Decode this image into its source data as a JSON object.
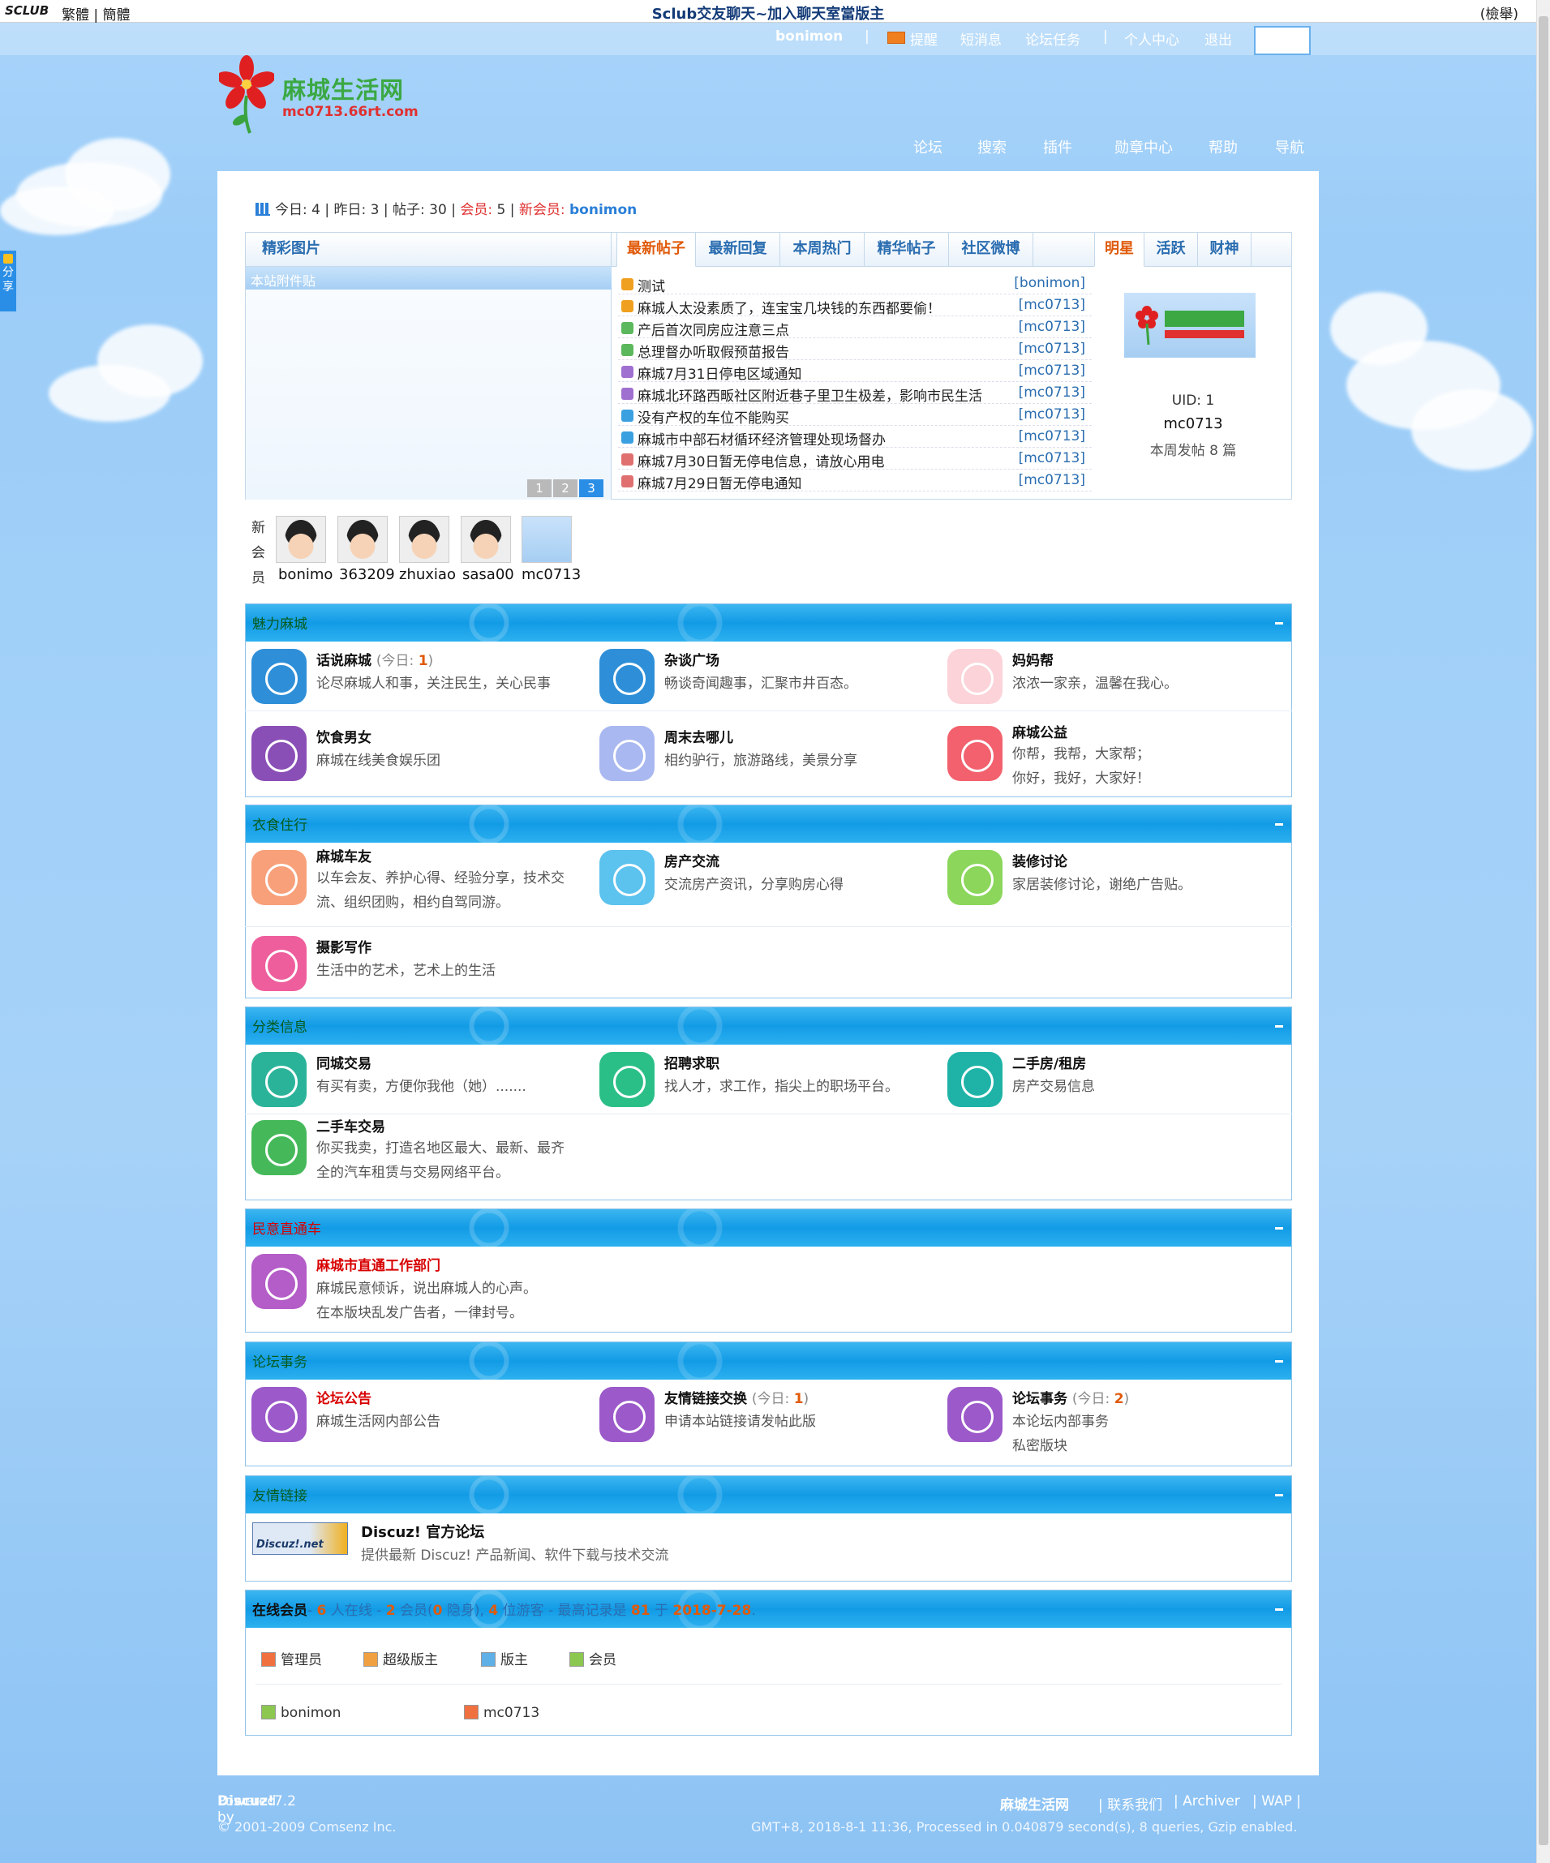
{
  "topbar": {
    "brand": "SCLUB",
    "lang_trad": "繁體",
    "lang_simp": "簡體",
    "marquee": "Sclub交友聊天~加入聊天室當版主",
    "report": "(檢舉)"
  },
  "userbar": {
    "username": "bonimon",
    "remind": "提醒",
    "sms": "短消息",
    "task": "论坛任务",
    "center": "个人中心",
    "logout": "退出",
    "sep": "|"
  },
  "logo": {
    "name": "麻城生活网",
    "url": "mc0713.66rt.com"
  },
  "nav": [
    "论坛",
    "搜索",
    "插件",
    "勋章中心",
    "帮助",
    "导航"
  ],
  "stats": {
    "today_label": "今日:",
    "today": "4",
    "yesterday_label": "昨日:",
    "yesterday": "3",
    "posts_label": "帖子:",
    "posts": "30",
    "members_label": "会员:",
    "members": "5",
    "newmember_label": "新会员:",
    "newmember": "bonimon"
  },
  "pics": {
    "tab": "精彩图片",
    "bar": "本站附件贴",
    "pages": [
      "1",
      "2",
      "3"
    ]
  },
  "post_tabs": [
    "最新帖子",
    "最新回复",
    "本周热门",
    "精华帖子",
    "社区微博"
  ],
  "posts": [
    {
      "title": "测试",
      "author": "[bonimon]",
      "color": "#f0a020"
    },
    {
      "title": "麻城人太没素质了，连宝宝几块钱的东西都要偷！",
      "author": "[mc0713]",
      "color": "#f0a020"
    },
    {
      "title": "产后首次同房应注意三点",
      "author": "[mc0713]",
      "color": "#5cb85c"
    },
    {
      "title": "总理督办听取假预苗报告",
      "author": "[mc0713]",
      "color": "#5cb85c"
    },
    {
      "title": "麻城7月31日停电区域通知",
      "author": "[mc0713]",
      "color": "#a070d0"
    },
    {
      "title": "麻城北环路西畈社区附近巷子里卫生极差，影响市民生活",
      "author": "[mc0713]",
      "color": "#a070d0"
    },
    {
      "title": "没有产权的车位不能购买",
      "author": "[mc0713]",
      "color": "#3aa0e0"
    },
    {
      "title": "麻城市中部石材循环经济管理处现场督办",
      "author": "[mc0713]",
      "color": "#3aa0e0"
    },
    {
      "title": "麻城7月30日暂无停电信息，请放心用电",
      "author": "[mc0713]",
      "color": "#e07070"
    },
    {
      "title": "麻城7月29日暂无停电通知",
      "author": "[mc0713]",
      "color": "#e07070"
    }
  ],
  "star_tabs": [
    "明星",
    "活跃",
    "财神"
  ],
  "star": {
    "uid": "UID: 1",
    "name": "mc0713",
    "week": "本周发帖 8 篇"
  },
  "new_members": {
    "label": "新\n会\n员",
    "names": [
      "bonimo",
      "363209",
      "zhuxiao",
      "sasa00",
      "mc0713"
    ]
  },
  "categories": [
    {
      "title": "魅力麻城",
      "forums": [
        {
          "name": "话说麻城",
          "today": "1",
          "desc": [
            "论尽麻城人和事，关注民生，关心民事"
          ],
          "color": "#2e8fd8"
        },
        {
          "name": "杂谈广场",
          "desc": [
            "畅谈奇闻趣事，汇聚市井百态。"
          ],
          "color": "#2e8fd8"
        },
        {
          "name": "妈妈帮",
          "desc": [
            "浓浓一家亲，温馨在我心。"
          ],
          "color": "#fbd3d8"
        },
        {
          "name": "饮食男女",
          "desc": [
            "麻城在线美食娱乐团"
          ],
          "color": "#8a4fb6"
        },
        {
          "name": "周末去哪儿",
          "desc": [
            "相约驴行，旅游路线，美景分享"
          ],
          "color": "#a9b8f0"
        },
        {
          "name": "麻城公益",
          "desc": [
            "你帮，我帮，大家帮；",
            "你好，我好，大家好！"
          ],
          "color": "#f2616d"
        }
      ]
    },
    {
      "title": "衣食住行",
      "forums": [
        {
          "name": "麻城车友",
          "desc": [
            "以车会友、养护心得、经验分享，技术交",
            "流、组织团购，相约自驾同游。"
          ],
          "color": "#f7a07a"
        },
        {
          "name": "房产交流",
          "desc": [
            "交流房产资讯，分享购房心得"
          ],
          "color": "#5cc2ee"
        },
        {
          "name": "装修讨论",
          "desc": [
            "家居装修讨论，谢绝广告贴。"
          ],
          "color": "#8bd65b"
        },
        {
          "name": "摄影写作",
          "desc": [
            "生活中的艺术，艺术上的生活"
          ],
          "color": "#ee5e9c"
        }
      ]
    },
    {
      "title": "分类信息",
      "forums": [
        {
          "name": "同城交易",
          "desc": [
            "有买有卖，方便你我他（她）......."
          ],
          "color": "#2bb39a"
        },
        {
          "name": "招聘求职",
          "desc": [
            "找人才，求工作，指尖上的职场平台。"
          ],
          "color": "#2bbf88"
        },
        {
          "name": "二手房/租房",
          "desc": [
            "房产交易信息"
          ],
          "color": "#1fb3a7"
        },
        {
          "name": "二手车交易",
          "desc": [
            "你买我卖，打造名地区最大、最新、最齐",
            "全的汽车租赁与交易网络平台。"
          ],
          "color": "#45b95a"
        }
      ]
    },
    {
      "title": "民意直通车",
      "forums": [
        {
          "name": "麻城市直通工作部门",
          "desc": [
            "麻城民意倾诉，说出麻城人的心声。",
            "在本版块乱发广告者，一律封号。"
          ],
          "color": "#b45cc8"
        }
      ]
    },
    {
      "title": "论坛事务",
      "forums": [
        {
          "name": "论坛公告",
          "desc": [
            "麻城生活网内部公告"
          ],
          "color": "#9b59c9"
        },
        {
          "name": "友情链接交换",
          "today": "1",
          "desc": [
            "申请本站链接请发帖此版"
          ],
          "color": "#9b59c9"
        },
        {
          "name": "论坛事务",
          "today": "2",
          "desc": [
            "本论坛内部事务",
            "私密版块"
          ],
          "color": "#9b59c9"
        }
      ]
    }
  ],
  "today_label": "(今日:",
  "today_close": ")",
  "links": {
    "title": "友情链接",
    "name": "Discuz! 官方论坛",
    "desc": "提供最新 Discuz! 产品新闻、软件下载与技术交流",
    "logo": "Discuz!.net"
  },
  "online": {
    "title": "在线会员",
    "summary_a": "- ",
    "online": "6",
    "summary_b": " 人在线 - ",
    "members": "2",
    "summary_c": " 会员(",
    "hidden": "0",
    "summary_d": " 隐身), ",
    "guests": "4",
    "summary_e": " 位游客 - 最高记录是 ",
    "record": "81",
    "summary_f": " 于 ",
    "record_date": "2018-7-28",
    "summary_g": ".",
    "legend": [
      "管理员",
      "超级版主",
      "版主",
      "会员"
    ],
    "users": [
      "bonimon",
      "mc0713"
    ]
  },
  "footer": {
    "powered": "Powered by ",
    "discuz": "Discuz!",
    "version": " 7.2",
    "copy": "© 2001-2009 Comsenz Inc.",
    "site": "麻城生活网",
    "contact": "| 联系我们",
    "archiver": "| Archiver",
    "wap": "| WAP |",
    "info": "GMT+8, 2018-8-1 11:36, Processed in 0.040879 second(s), 8 queries, Gzip enabled."
  },
  "share": "分享"
}
